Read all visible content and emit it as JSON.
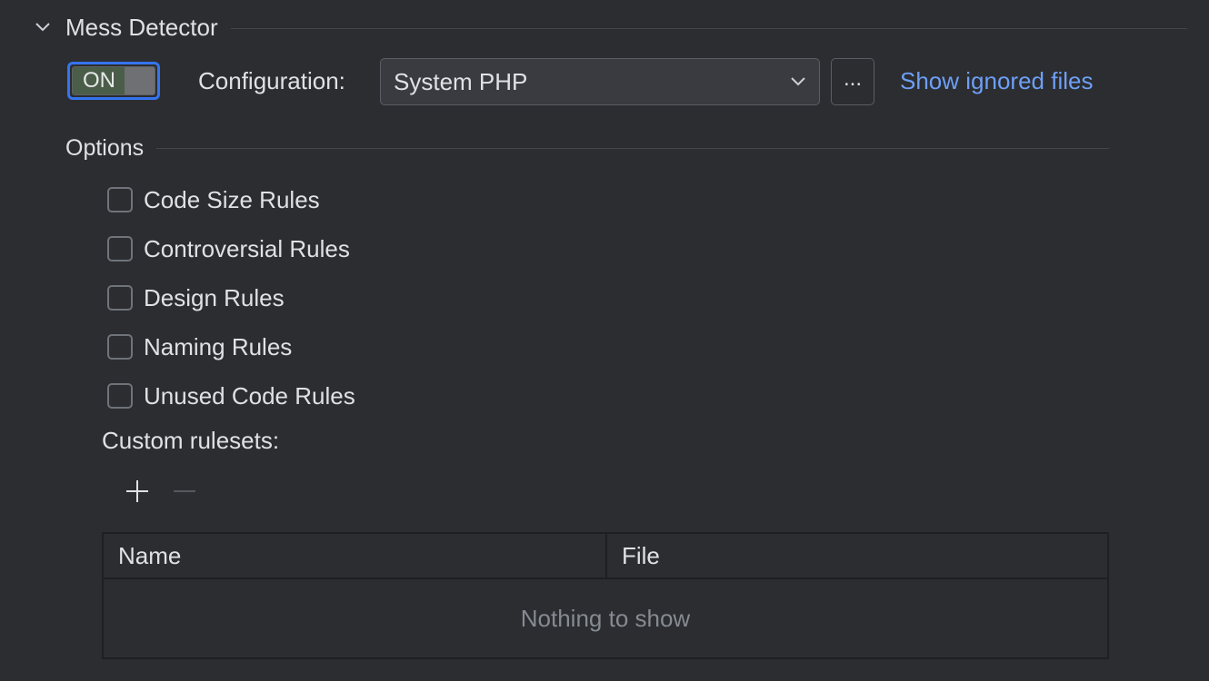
{
  "section": {
    "title": "Mess Detector",
    "expanded_icon": "chevron-down-icon"
  },
  "toggle": {
    "label": "ON",
    "state": "on"
  },
  "configuration": {
    "label": "Configuration:",
    "selected": "System PHP",
    "browse_label": "...",
    "ignored_link": "Show ignored files"
  },
  "options": {
    "title": "Options",
    "checkboxes": [
      {
        "label": "Code Size Rules",
        "checked": false
      },
      {
        "label": "Controversial Rules",
        "checked": false
      },
      {
        "label": "Design Rules",
        "checked": false
      },
      {
        "label": "Naming Rules",
        "checked": false
      },
      {
        "label": "Unused Code Rules",
        "checked": false
      }
    ]
  },
  "custom_rulesets": {
    "label": "Custom rulesets:",
    "add_icon": "plus-icon",
    "remove_icon": "minus-icon",
    "table": {
      "columns": [
        "Name",
        "File"
      ],
      "rows": [],
      "empty_text": "Nothing to show"
    }
  },
  "colors": {
    "background": "#2b2d30",
    "accent": "#3574f0",
    "link": "#6e9ff6",
    "toggle_on": "#4a5d48"
  }
}
